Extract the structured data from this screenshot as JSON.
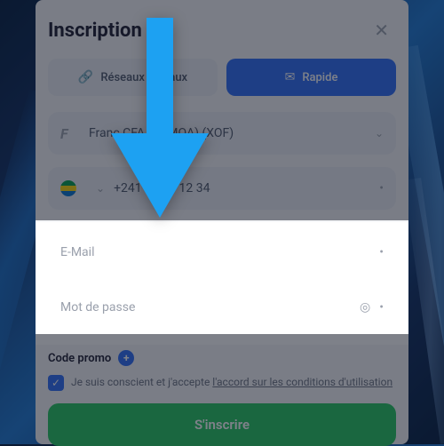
{
  "modal": {
    "title": "Inscription",
    "tabs": {
      "social": "Réseaux sociaux",
      "rapid": "Rapide"
    },
    "currency": {
      "label": "Franc CFA (UEMOA) (XOF)"
    },
    "phone": {
      "value": "+241 74 03 12 34"
    },
    "email": {
      "placeholder": "E-Mail"
    },
    "password": {
      "placeholder": "Mot de passe"
    },
    "promo": {
      "label": "Code promo"
    },
    "consent": {
      "prefix": "Je suis conscient et j'accepte ",
      "link": "l'accord sur les conditions d'utilisation"
    },
    "submit": "S'inscrire"
  }
}
